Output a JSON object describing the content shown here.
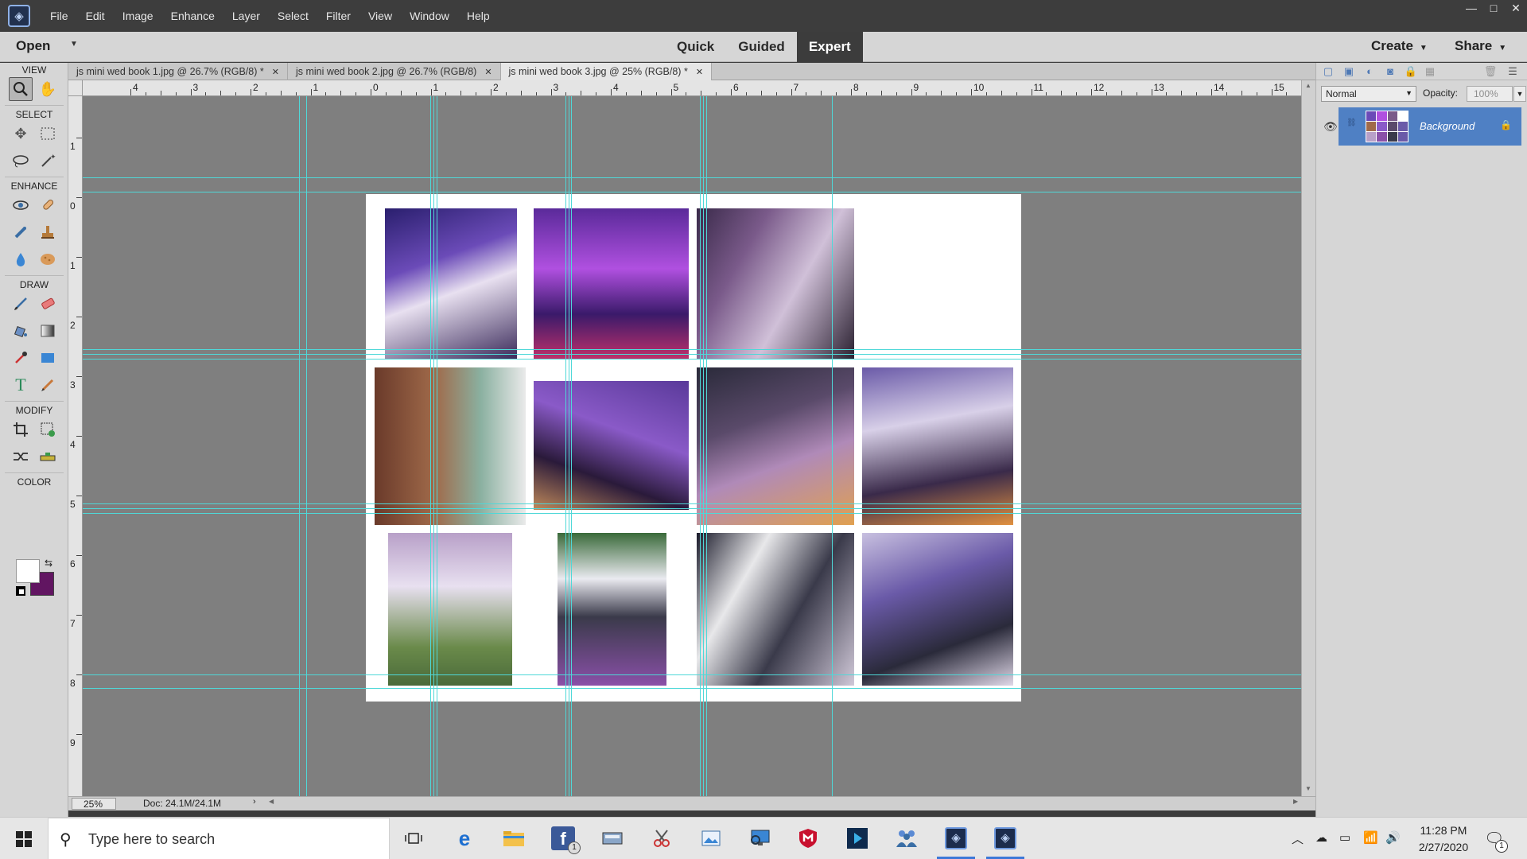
{
  "menu": [
    "File",
    "Edit",
    "Image",
    "Enhance",
    "Layer",
    "Select",
    "Filter",
    "View",
    "Window",
    "Help"
  ],
  "window_controls": {
    "minimize": "—",
    "maximize": "□",
    "close": "✕"
  },
  "modebar": {
    "open": "Open",
    "modes": [
      "Quick",
      "Guided",
      "Expert"
    ],
    "active_mode": "Expert",
    "create": "Create",
    "share": "Share"
  },
  "toolbox": {
    "sections": {
      "view": "VIEW",
      "select": "SELECT",
      "enhance": "ENHANCE",
      "draw": "DRAW",
      "modify": "MODIFY",
      "color": "COLOR"
    },
    "foreground_color": "#ffffff",
    "background_color": "#611561"
  },
  "doc_tabs": [
    {
      "label": "js mini wed book 1.jpg @ 26.7% (RGB/8) *",
      "close": "✕"
    },
    {
      "label": "js mini wed book 2.jpg @ 26.7% (RGB/8)",
      "close": "✕"
    },
    {
      "label": "js mini wed book 3.jpg @ 25% (RGB/8) *",
      "close": "✕",
      "active": true
    }
  ],
  "ruler_top_labels": [
    "4",
    "3",
    "2",
    "1",
    "0",
    "1",
    "2",
    "3",
    "4",
    "5",
    "6",
    "7",
    "8",
    "9",
    "10",
    "11",
    "12",
    "13",
    "14",
    "15"
  ],
  "ruler_left_labels": [
    "1",
    "0",
    "1",
    "2",
    "3",
    "4",
    "5",
    "6",
    "7",
    "8",
    "9"
  ],
  "status": {
    "zoom": "25%",
    "doc_size": "Doc: 24.1M/24.1M"
  },
  "layers_panel": {
    "blend_mode": "Normal",
    "opacity_label": "Opacity:",
    "opacity_value": "100%",
    "layer_name": "Background"
  },
  "taskbar": {
    "search_placeholder": "Type here to search",
    "facebook_badge": "1",
    "time": "11:28 PM",
    "date": "2/27/2020",
    "notification_count": "1"
  },
  "colors": {
    "guide": "#4fd8d8",
    "accent": "#3c78d8",
    "layer_selected": "#4f80c4"
  }
}
